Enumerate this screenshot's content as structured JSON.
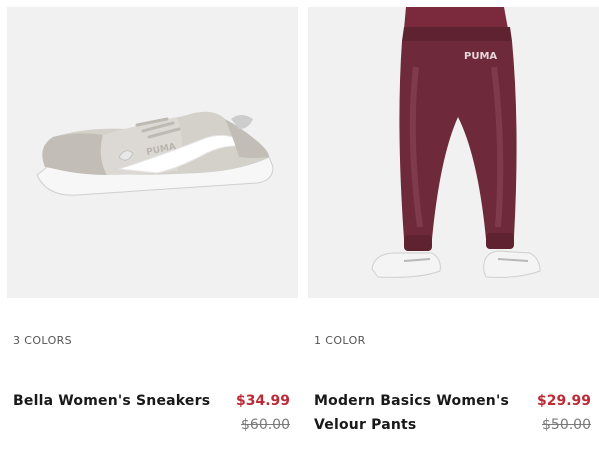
{
  "products": [
    {
      "colors_label": "3 COLORS",
      "name": "Bella Women's Sneakers",
      "sale_price": "$34.99",
      "original_price": "$60.00",
      "image_icon": "sneaker-image",
      "image_logo_text": "PUMA"
    },
    {
      "colors_label": "1 COLOR",
      "name": "Modern Basics Women's Velour Pants",
      "sale_price": "$29.99",
      "original_price": "$50.00",
      "image_icon": "velour-pants-image",
      "image_logo_text": "PUMA"
    }
  ],
  "colors": {
    "sale_price": "#ba2b36",
    "original_price": "#7a7a7a",
    "image_background": "#f1f1f1",
    "pants": "#6e2a3a",
    "sneaker": "#cfcbc5"
  }
}
